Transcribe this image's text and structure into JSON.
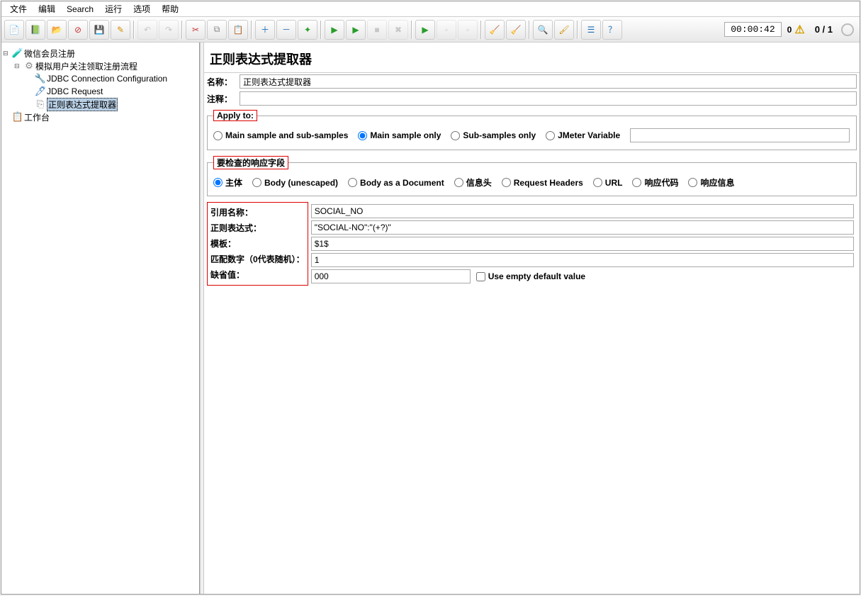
{
  "menu": {
    "file": "文件",
    "edit": "编辑",
    "search": "Search",
    "run": "运行",
    "options": "选项",
    "help": "帮助"
  },
  "toolbar": {
    "timer": "00:00:42",
    "warnings": "0",
    "counter": "0 / 1"
  },
  "tree": {
    "root": "微信会员注册",
    "plan": "模拟用户关注领取注册流程",
    "jdbc_conf": "JDBC Connection Configuration",
    "jdbc_req": "JDBC Request",
    "regex": "正则表达式提取器",
    "workbench": "工作台"
  },
  "panel": {
    "title": "正则表达式提取器",
    "name_label": "名称：",
    "name_value": "正则表达式提取器",
    "comment_label": "注释：",
    "apply_legend": "Apply to:",
    "apply": {
      "main_sub": "Main sample and sub-samples",
      "main": "Main sample only",
      "sub": "Sub-samples only",
      "jvar": "JMeter Variable"
    },
    "field_legend": "要检查的响应字段",
    "field": {
      "body": "主体",
      "body_un": "Body (unescaped)",
      "body_doc": "Body as a Document",
      "headers_cn": "信息头",
      "req_headers": "Request Headers",
      "url": "URL",
      "code": "响应代码",
      "msg": "响应信息"
    },
    "form": {
      "refname_label": "引用名称：",
      "refname_value": "SOCIAL_NO",
      "regex_label": "正则表达式：",
      "regex_value": "\"SOCIAL-NO\":\"(+?)\"",
      "template_label": "模板：",
      "template_value": "$1$",
      "match_label": "匹配数字（0代表随机）：",
      "match_value": "1",
      "default_label": "缺省值：",
      "default_value": "000",
      "empty_check": "Use empty default value"
    }
  }
}
